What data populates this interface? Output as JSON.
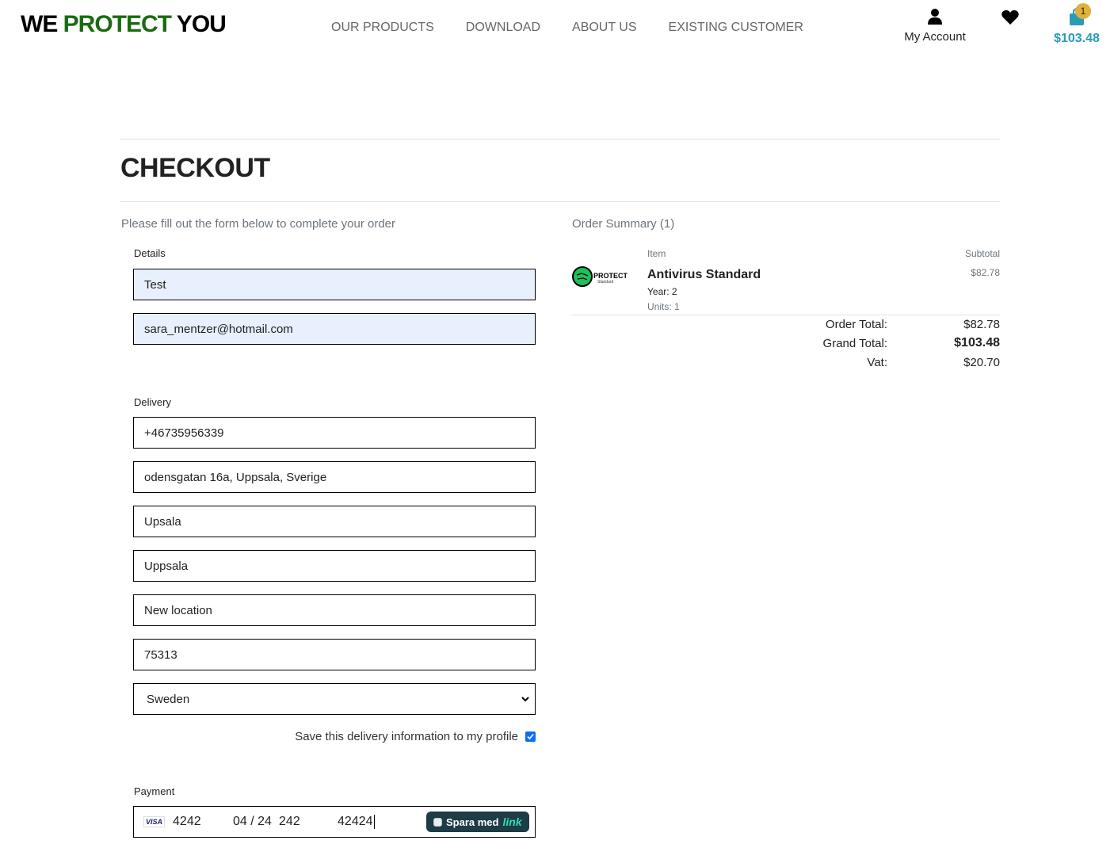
{
  "header": {
    "logo": {
      "part1": "WE ",
      "part2": "PROTECT",
      "part3": " YOU"
    },
    "nav": [
      "OUR PRODUCTS",
      "DOWNLOAD",
      "ABOUT US",
      "EXISTING CUSTOMER"
    ],
    "account_label": "My Account",
    "cart_count": "1",
    "cart_total": "$103.48",
    "icons": {
      "account": "user-icon",
      "wishlist": "heart-icon",
      "cart": "shopping-bag-icon"
    }
  },
  "page": {
    "title": "CHECKOUT",
    "intro": "Please fill out the form below to complete your order"
  },
  "form": {
    "details_label": "Details",
    "details": [
      "Test",
      "sara_mentzer@hotmail.com"
    ],
    "delivery_label": "Delivery",
    "delivery": [
      "+46735956339",
      "odensgatan 16a, Uppsala, Sverige",
      "Upsala",
      "Uppsala",
      "New location",
      "75313"
    ],
    "country": "Sweden",
    "save_label": "Save this delivery information to my profile",
    "save_checked": true,
    "payment_label": "Payment",
    "payment": {
      "card_brand": "VISA",
      "card_number": "4242",
      "expiry": "04 / 24",
      "cvc": "242",
      "postal": "42424",
      "link_prefix": "Spara med",
      "link_word": "link"
    }
  },
  "summary": {
    "title": "Order Summary (1)",
    "col_item": "Item",
    "col_subtotal": "Subtotal",
    "product": {
      "logo_text": "PROTECT",
      "logo_sub": "Standard",
      "name": "Antivirus Standard",
      "year": "Year: 2",
      "units": "Units: 1",
      "subtotal": "$82.78"
    },
    "totals": [
      {
        "label": "Order Total:",
        "value": "$82.78"
      },
      {
        "label": "Grand Total:",
        "value": "$103.48"
      },
      {
        "label": "Vat:",
        "value": "$20.70"
      }
    ]
  },
  "colors": {
    "brand_green": "#1a6b12",
    "cart_blue": "#2a9bb7",
    "badge_gold": "#e2b13c",
    "autofill": "#e8f0fe"
  }
}
